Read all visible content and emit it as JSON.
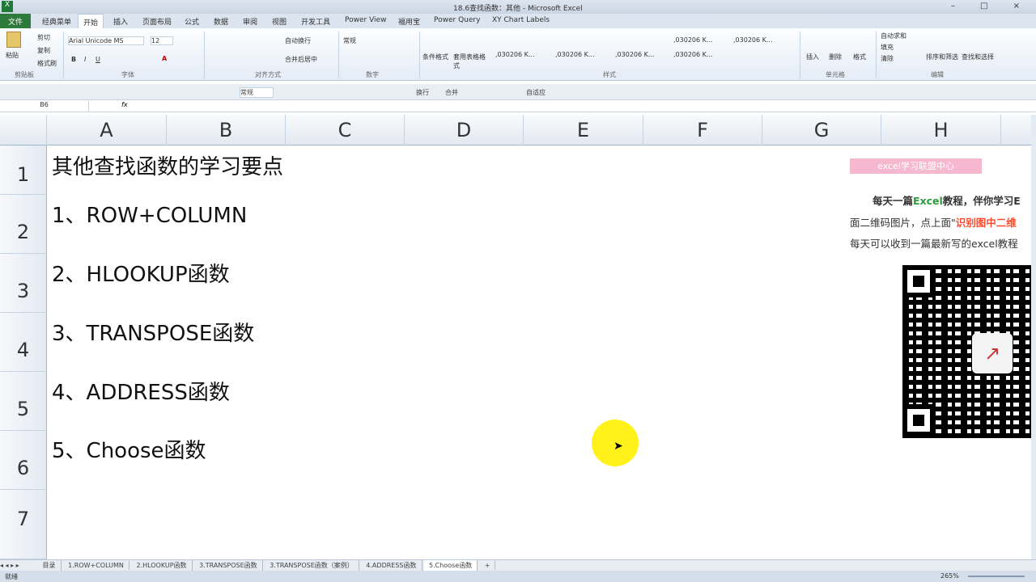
{
  "window": {
    "title": "18.6查找函数：其他 - Microsoft Excel",
    "controls": "– □ ×"
  },
  "ribbon_tabs": [
    "文件",
    "经典菜单",
    "开始",
    "插入",
    "页面布局",
    "公式",
    "数据",
    "审阅",
    "视图",
    "开发工具",
    "Power View",
    "福用宝",
    "Power Query",
    "XY Chart Labels"
  ],
  "ribbon": {
    "paste": "粘贴",
    "cut": "剪切",
    "copy": "复制",
    "format_painter": "格式刷",
    "font": "Arial Unicode MS",
    "size": "12",
    "wrap": "自动换行",
    "merge": "合并后居中",
    "number_format": "常规",
    "cond_format": "条件格式",
    "table_format": "套用表格格式",
    "style_samples": [
      ",030206  K...",
      ",030206  K...",
      ",030206  K...",
      ",030206  K...",
      ",030206  K...",
      ",030206  K..."
    ],
    "insert": "插入",
    "delete": "删除",
    "format": "格式",
    "autosum": "自动求和",
    "fill": "填充",
    "clear": "清除",
    "sort": "排序和筛选",
    "find": "查找和选择",
    "groups": [
      "剪贴板",
      "字体",
      "对齐方式",
      "数字",
      "样式",
      "单元格",
      "编辑"
    ]
  },
  "qat": {
    "format_box": "常规",
    "wrap": "换行",
    "merge": "合并",
    "fit": "自适应"
  },
  "formula_bar": {
    "name_box": "B6",
    "fx": "fx",
    "value": ""
  },
  "columns": [
    "A",
    "B",
    "C",
    "D",
    "E",
    "F",
    "G",
    "H"
  ],
  "rows": [
    "1",
    "2",
    "3",
    "4",
    "5",
    "6",
    "7"
  ],
  "cells": [
    "其他查找函数的学习要点",
    "1、ROW+COLUMN",
    "2、HLOOKUP函数",
    "3、TRANSPOSE函数",
    "4、ADDRESS函数",
    "5、Choose函数"
  ],
  "promo": {
    "banner": "excel学习联盟中心",
    "line1_pre": "每天一篇",
    "line1_brand": "Excel",
    "line1_post": "教程，伴你学习E",
    "line2_pre": "面二维码图片，点上面\"",
    "line2_hl": "识别图中二维",
    "line3": "每天可以收到一篇最新写的excel教程"
  },
  "sheet_tabs": [
    "目录",
    "1.ROW+COLUMN",
    "2.HLOOKUP函数",
    "3.TRANSPOSE函数",
    "3.TRANSPOSE函数（案例）",
    "4.ADDRESS函数",
    "5.Choose函数"
  ],
  "status": {
    "ready": "就绪",
    "zoom": "265%"
  },
  "colors": {
    "file_tab": "#2d7a3b",
    "brand_green": "#2e9a3c",
    "highlight_red": "#ff4b2b",
    "banner": "#f6b8cf"
  }
}
